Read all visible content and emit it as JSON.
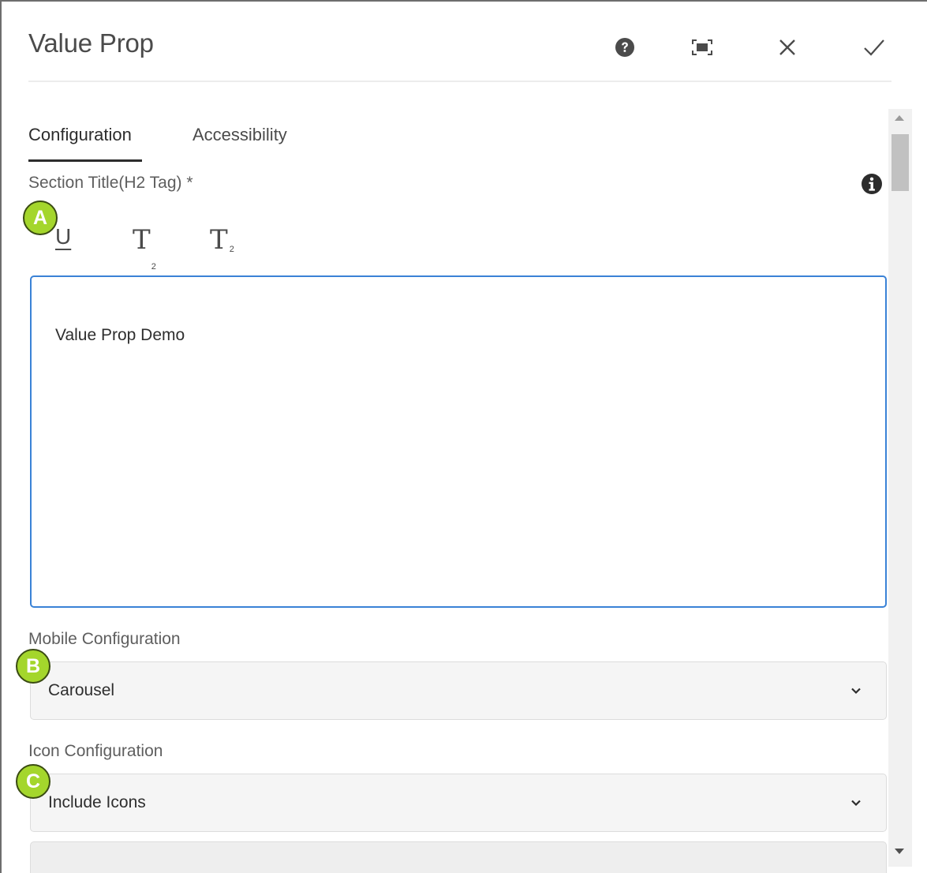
{
  "dialog": {
    "title": "Value Prop",
    "actions": {
      "help_icon": "help-circle-icon",
      "fullscreen_icon": "fullscreen-icon",
      "close_icon": "close-icon",
      "done_icon": "checkmark-icon"
    }
  },
  "tabs": [
    {
      "label": "Configuration",
      "active": true
    },
    {
      "label": "Accessibility",
      "active": false
    }
  ],
  "section_title": {
    "label": "Section Title(H2 Tag) *",
    "info_icon": "info-icon",
    "toolbar": {
      "underline": "U",
      "subscript": "T",
      "subscript_mark": "2",
      "superscript": "T",
      "superscript_mark": "2"
    },
    "value": "Value Prop Demo"
  },
  "mobile_configuration": {
    "label": "Mobile Configuration",
    "selected": "Carousel"
  },
  "icon_configuration": {
    "label": "Icon Configuration",
    "selected": "Include Icons"
  },
  "markers": [
    "A",
    "B",
    "C"
  ],
  "colors": {
    "accent_focus": "#3a82d6",
    "marker_fill": "#a4d62c",
    "text": "#4b4b4b"
  }
}
